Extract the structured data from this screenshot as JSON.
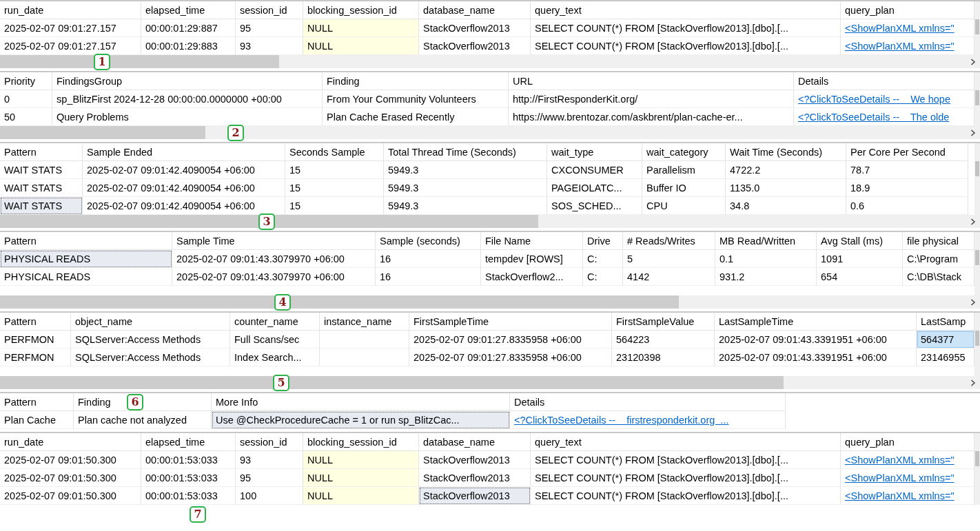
{
  "grids": [
    {
      "badge": "1",
      "hscroll": true,
      "vscroll": true,
      "active": false,
      "columns": [
        {
          "label": "run_date",
          "kind": "text"
        },
        {
          "label": "elapsed_time",
          "kind": "text"
        },
        {
          "label": "session_id",
          "kind": "text"
        },
        {
          "label": "blocking_session_id",
          "kind": "null_value"
        },
        {
          "label": "database_name",
          "kind": "text"
        },
        {
          "label": "query_text",
          "kind": "text"
        },
        {
          "label": "query_plan",
          "kind": "link"
        }
      ],
      "rows": [
        {
          "kind": "full",
          "cells": [
            {
              "text": "2025-02-07 09:01:27.157",
              "selected": false
            },
            {
              "text": "00:00:01:29:887",
              "selected": false
            },
            {
              "text": "95",
              "selected": false
            },
            {
              "text": "NULL",
              "selected": false
            },
            {
              "text": "StackOverflow2013",
              "selected": false
            },
            {
              "text": "SELECT COUNT(*) FROM [StackOverflow2013].[dbo].[...",
              "selected": false
            },
            {
              "text": "<ShowPlanXML xmlns=\"",
              "selected": false
            }
          ]
        },
        {
          "kind": "full",
          "cells": [
            {
              "text": "2025-02-07 09:01:27.157",
              "selected": false
            },
            {
              "text": "00:00:01:29:883",
              "selected": false
            },
            {
              "text": "93",
              "selected": false
            },
            {
              "text": "NULL",
              "selected": false
            },
            {
              "text": "StackOverflow2013",
              "selected": false
            },
            {
              "text": "SELECT COUNT(*) FROM [StackOverflow2013].[dbo].[...",
              "selected": false
            },
            {
              "text": "<ShowPlanXML xmlns=\"",
              "selected": false
            }
          ]
        }
      ]
    },
    {
      "badge": "2",
      "hscroll": true,
      "vscroll": true,
      "active": false,
      "columns": [
        {
          "label": "Priority",
          "kind": "text"
        },
        {
          "label": "FindingsGroup",
          "kind": "text"
        },
        {
          "label": "Finding",
          "kind": "text"
        },
        {
          "label": "URL",
          "kind": "text"
        },
        {
          "label": "Details",
          "kind": "link"
        }
      ],
      "rows": [
        {
          "kind": "full",
          "cells": [
            {
              "text": "0",
              "selected": false
            },
            {
              "text": "sp_BlitzFirst 2024-12-28 00:00:00.0000000 +00:00",
              "selected": false
            },
            {
              "text": "From Your Community Volunteers",
              "selected": false
            },
            {
              "text": "http://FirstResponderKit.org/",
              "selected": false
            },
            {
              "text": "<?ClickToSeeDetails --    We hope",
              "selected": false
            }
          ]
        },
        {
          "kind": "full",
          "cells": [
            {
              "text": "50",
              "selected": false
            },
            {
              "text": "Query Problems",
              "selected": false
            },
            {
              "text": "Plan Cache Erased Recently",
              "selected": false
            },
            {
              "text": "https://www.brentozar.com/askbrent/plan-cache-er...",
              "selected": false
            },
            {
              "text": "<?ClickToSeeDetails --    The olde",
              "selected": false
            }
          ]
        }
      ]
    },
    {
      "badge": "3",
      "hscroll": true,
      "vscroll": true,
      "active": false,
      "columns": [
        {
          "label": "Pattern",
          "kind": "text"
        },
        {
          "label": "Sample Ended",
          "kind": "text"
        },
        {
          "label": "Seconds Sample",
          "kind": "text"
        },
        {
          "label": "Total Thread Time (Seconds)",
          "kind": "text"
        },
        {
          "label": "wait_type",
          "kind": "text"
        },
        {
          "label": "wait_category",
          "kind": "text"
        },
        {
          "label": "Wait Time (Seconds)",
          "kind": "text"
        },
        {
          "label": "Per Core Per Second",
          "kind": "text"
        }
      ],
      "rows": [
        {
          "kind": "full",
          "cells": [
            {
              "text": "WAIT STATS",
              "selected": false
            },
            {
              "text": "2025-02-07 09:01:42.4090054 +06:00",
              "selected": false
            },
            {
              "text": "15",
              "selected": false
            },
            {
              "text": "5949.3",
              "selected": false
            },
            {
              "text": "CXCONSUMER",
              "selected": false
            },
            {
              "text": "Parallelism",
              "selected": false
            },
            {
              "text": "4722.2",
              "selected": false
            },
            {
              "text": "78.7",
              "selected": false
            }
          ]
        },
        {
          "kind": "full",
          "cells": [
            {
              "text": "WAIT STATS",
              "selected": false
            },
            {
              "text": "2025-02-07 09:01:42.4090054 +06:00",
              "selected": false
            },
            {
              "text": "15",
              "selected": false
            },
            {
              "text": "5949.3",
              "selected": false
            },
            {
              "text": "PAGEIOLATC...",
              "selected": false
            },
            {
              "text": "Buffer IO",
              "selected": false
            },
            {
              "text": "1135.0",
              "selected": false
            },
            {
              "text": "18.9",
              "selected": false
            }
          ]
        },
        {
          "kind": "full",
          "cells": [
            {
              "text": "WAIT STATS",
              "selected": true
            },
            {
              "text": "2025-02-07 09:01:42.4090054 +06:00",
              "selected": false
            },
            {
              "text": "15",
              "selected": false
            },
            {
              "text": "5949.3",
              "selected": false
            },
            {
              "text": "SOS_SCHED...",
              "selected": false
            },
            {
              "text": "CPU",
              "selected": false
            },
            {
              "text": "34.8",
              "selected": false
            },
            {
              "text": "0.6",
              "selected": false
            }
          ]
        }
      ]
    },
    {
      "badge": "4",
      "hscroll": true,
      "vscroll": true,
      "active": false,
      "columns": [
        {
          "label": "Pattern",
          "kind": "text"
        },
        {
          "label": "Sample Time",
          "kind": "text"
        },
        {
          "label": "Sample (seconds)",
          "kind": "text"
        },
        {
          "label": "File Name",
          "kind": "text"
        },
        {
          "label": "Drive",
          "kind": "text"
        },
        {
          "label": "# Reads/Writes",
          "kind": "text"
        },
        {
          "label": "MB Read/Written",
          "kind": "text"
        },
        {
          "label": "Avg Stall (ms)",
          "kind": "text"
        },
        {
          "label": "file physical",
          "kind": "text"
        }
      ],
      "rows": [
        {
          "kind": "full",
          "cells": [
            {
              "text": "PHYSICAL READS",
              "selected": true
            },
            {
              "text": "2025-02-07 09:01:43.3079970 +06:00",
              "selected": false
            },
            {
              "text": "16",
              "selected": false
            },
            {
              "text": "tempdev [ROWS]",
              "selected": false
            },
            {
              "text": "C:",
              "selected": false
            },
            {
              "text": "5",
              "selected": false
            },
            {
              "text": "0.1",
              "selected": false
            },
            {
              "text": "1091",
              "selected": false
            },
            {
              "text": "C:\\Program",
              "selected": false
            }
          ]
        },
        {
          "kind": "full",
          "cells": [
            {
              "text": "PHYSICAL READS",
              "selected": false
            },
            {
              "text": "2025-02-07 09:01:43.3079970 +06:00",
              "selected": false
            },
            {
              "text": "16",
              "selected": false
            },
            {
              "text": "StackOverflow2...",
              "selected": false
            },
            {
              "text": "C:",
              "selected": false
            },
            {
              "text": "4142",
              "selected": false
            },
            {
              "text": "931.2",
              "selected": false
            },
            {
              "text": "654",
              "selected": false
            },
            {
              "text": "C:\\DB\\Stack",
              "selected": false
            }
          ]
        }
      ]
    },
    {
      "badge": "5",
      "hscroll": true,
      "vscroll": true,
      "active": true,
      "columns": [
        {
          "label": "Pattern",
          "kind": "text"
        },
        {
          "label": "object_name",
          "kind": "text"
        },
        {
          "label": "counter_name",
          "kind": "text"
        },
        {
          "label": "instance_name",
          "kind": "text"
        },
        {
          "label": "FirstSampleTime",
          "kind": "text"
        },
        {
          "label": "FirstSampleValue",
          "kind": "text"
        },
        {
          "label": "LastSampleTime",
          "kind": "text"
        },
        {
          "label": "LastSamp",
          "kind": "text"
        }
      ],
      "rows": [
        {
          "kind": "full",
          "cells": [
            {
              "text": "PERFMON",
              "selected": false
            },
            {
              "text": "SQLServer:Access Methods",
              "selected": false
            },
            {
              "text": "Full Scans/sec",
              "selected": false
            },
            {
              "selected": false
            },
            {
              "text": "2025-02-07 09:01:27.8335958 +06:00",
              "selected": false
            },
            {
              "text": "564223",
              "selected": false
            },
            {
              "text": "2025-02-07 09:01:43.3391951 +06:00",
              "selected": false
            },
            {
              "text": "564377",
              "selected": true
            }
          ]
        },
        {
          "kind": "full",
          "cells": [
            {
              "text": "PERFMON",
              "selected": false
            },
            {
              "text": "SQLServer:Access Methods",
              "selected": false
            },
            {
              "text": "Index Search...",
              "selected": false
            },
            {
              "selected": false
            },
            {
              "text": "2025-02-07 09:01:27.8335958 +06:00",
              "selected": false
            },
            {
              "text": "23120398",
              "selected": false
            },
            {
              "text": "2025-02-07 09:01:43.3391951 +06:00",
              "selected": false
            },
            {
              "text": "23146955",
              "selected": false
            }
          ]
        }
      ]
    },
    {
      "badge": "6",
      "hscroll": false,
      "vscroll": false,
      "active": false,
      "columns": [
        {
          "label": "Pattern",
          "kind": "text"
        },
        {
          "label": "Finding",
          "kind": "text"
        },
        {
          "label": "More Info",
          "kind": "text"
        },
        {
          "label": "Details",
          "kind": "link"
        }
      ],
      "rows": [
        {
          "kind": "full",
          "cells": [
            {
              "text": "Plan Cache",
              "selected": false
            },
            {
              "text": "Plan cache not analyzed",
              "selected": false
            },
            {
              "text": "Use @CheckProcedureCache = 1 or run sp_BlitzCac...",
              "selected": true
            },
            {
              "text": "<?ClickToSeeDetails --    firstresponderkit.org  ...",
              "selected": false
            }
          ]
        }
      ]
    },
    {
      "badge": "7",
      "hscroll": false,
      "vscroll": true,
      "active": false,
      "columns": [
        {
          "label": "run_date",
          "kind": "text"
        },
        {
          "label": "elapsed_time",
          "kind": "text"
        },
        {
          "label": "session_id",
          "kind": "text"
        },
        {
          "label": "blocking_session_id",
          "kind": "null_value"
        },
        {
          "label": "database_name",
          "kind": "text"
        },
        {
          "label": "query_text",
          "kind": "text"
        },
        {
          "label": "query_plan",
          "kind": "link"
        }
      ],
      "rows": [
        {
          "kind": "full",
          "cells": [
            {
              "text": "2025-02-07 09:01:50.300",
              "selected": false
            },
            {
              "text": "00:00:01:53:033",
              "selected": false
            },
            {
              "text": "93",
              "selected": false
            },
            {
              "text": "NULL",
              "selected": false
            },
            {
              "text": "StackOverflow2013",
              "selected": false
            },
            {
              "text": "SELECT COUNT(*) FROM [StackOverflow2013].[dbo].[...",
              "selected": false
            },
            {
              "text": "<ShowPlanXML xmlns=\"",
              "selected": false
            }
          ]
        },
        {
          "kind": "full",
          "cells": [
            {
              "text": "2025-02-07 09:01:50.300",
              "selected": false
            },
            {
              "text": "00:00:01:53:033",
              "selected": false
            },
            {
              "text": "95",
              "selected": false
            },
            {
              "text": "NULL",
              "selected": false
            },
            {
              "text": "StackOverflow2013",
              "selected": false
            },
            {
              "text": "SELECT COUNT(*) FROM [StackOverflow2013].[dbo].[...",
              "selected": false
            },
            {
              "text": "<ShowPlanXML xmlns=\"",
              "selected": false
            }
          ]
        },
        {
          "kind": "full",
          "cells": [
            {
              "text": "2025-02-07 09:01:50.300",
              "selected": false
            },
            {
              "text": "00:00:01:53:033",
              "selected": false
            },
            {
              "text": "100",
              "selected": false
            },
            {
              "text": "NULL",
              "selected": false
            },
            {
              "text": "StackOverflow2013",
              "selected": true
            },
            {
              "text": "SELECT COUNT(*) FROM [StackOverflow2013].[dbo].[...",
              "selected": false
            },
            {
              "text": "<ShowPlanXML xmlns=\"",
              "selected": false
            }
          ]
        }
      ]
    }
  ]
}
